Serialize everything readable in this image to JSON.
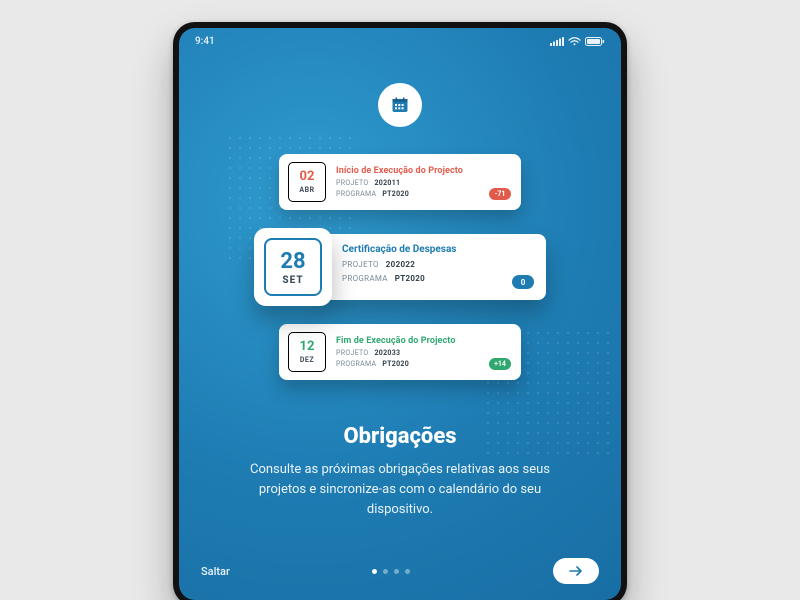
{
  "statusbar": {
    "time": "9:41"
  },
  "onboarding": {
    "title": "Obrigações",
    "body": "Consulte as próximas obrigações relativas aos seus projetos e sincronize-as com o calendário do seu dispositivo.",
    "skip_label": "Saltar",
    "page_index": 0,
    "page_count": 4
  },
  "meta_labels": {
    "project": "PROJETO",
    "program": "PROGRAMA"
  },
  "obligations": [
    {
      "day": "02",
      "month": "ABR",
      "title": "Início de Execução do Projecto",
      "project": "202011",
      "program": "PT2020",
      "badge": "-71",
      "accent": "#e25b4a"
    },
    {
      "day": "28",
      "month": "SET",
      "title": "Certificação de Despesas",
      "project": "202022",
      "program": "PT2020",
      "badge": "0",
      "accent": "#1e7cb3",
      "featured": true
    },
    {
      "day": "12",
      "month": "DEZ",
      "title": "Fim de Execução do Projecto",
      "project": "202033",
      "program": "PT2020",
      "badge": "+14",
      "accent": "#2fa86f"
    }
  ],
  "colors": {
    "background": "#1e7cb3",
    "danger": "#e25b4a",
    "success": "#2fa86f",
    "primary": "#1e7cb3"
  }
}
